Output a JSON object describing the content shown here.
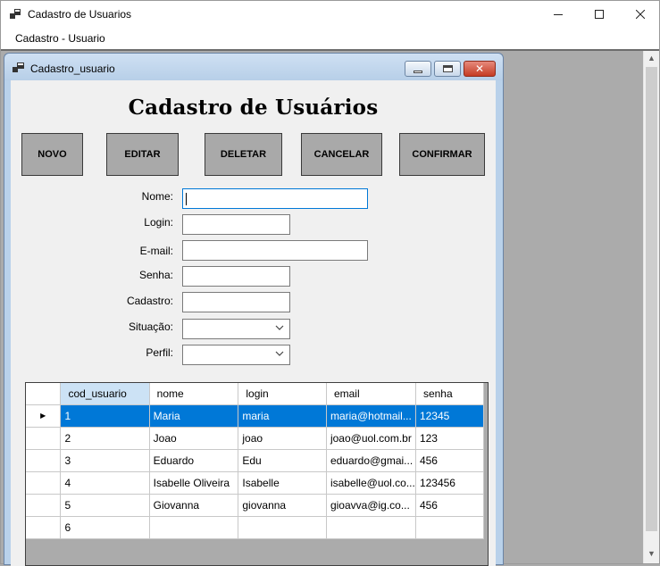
{
  "window": {
    "title": "Cadastro de Usuarios"
  },
  "menu": {
    "items": [
      "Cadastro - Usuario"
    ]
  },
  "child_window": {
    "title": "Cadastro_usuario"
  },
  "form": {
    "heading": "Cadastro de Usuários",
    "buttons": {
      "novo": "NOVO",
      "editar": "EDITAR",
      "deletar": "DELETAR",
      "cancelar": "CANCELAR",
      "confirmar": "CONFIRMAR"
    },
    "labels": {
      "nome": "Nome:",
      "login": "Login:",
      "email": "E-mail:",
      "senha": "Senha:",
      "cadastro": "Cadastro:",
      "situacao": "Situação:",
      "perfil": "Perfil:"
    },
    "values": {
      "nome": "",
      "login": "",
      "email": "",
      "senha": "",
      "cadastro": "",
      "situacao": "",
      "perfil": ""
    }
  },
  "grid": {
    "columns": [
      "cod_usuario",
      "nome",
      "login",
      "email",
      "senha"
    ],
    "selected_row_index": 0,
    "rows": [
      [
        "1",
        "Maria",
        "maria",
        "maria@hotmail...",
        "12345"
      ],
      [
        "2",
        "Joao",
        "joao",
        "joao@uol.com.br",
        "123"
      ],
      [
        "3",
        "Eduardo",
        "Edu",
        "eduardo@gmai...",
        "456"
      ],
      [
        "4",
        "Isabelle Oliveira",
        "Isabelle",
        "isabelle@uol.co...",
        "123456"
      ],
      [
        "5",
        "Giovanna",
        "giovanna",
        "gioavva@ig.co...",
        "456"
      ],
      [
        "6",
        "",
        "",
        "",
        ""
      ]
    ]
  }
}
